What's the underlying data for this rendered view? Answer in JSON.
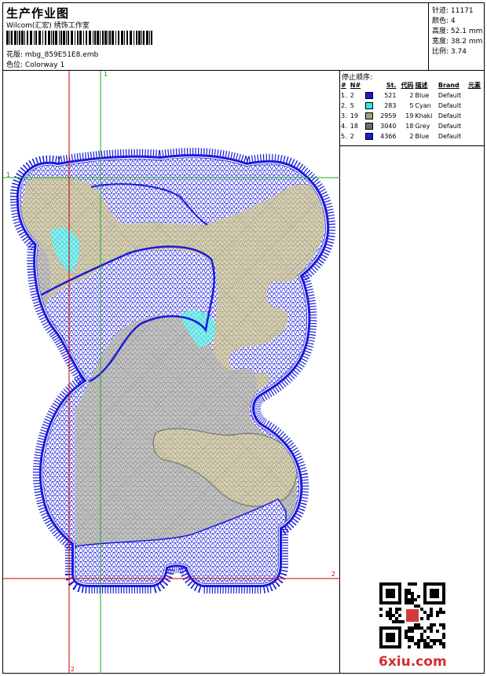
{
  "header": {
    "title": "生产作业图",
    "company": "Wilcom(汇宏) 绣饰工作室",
    "design_label": "花版:",
    "design_value": "mbg_859E51E8.emb",
    "colorway_label": "色位:",
    "colorway_value": "Colorway 1"
  },
  "stats": [
    {
      "label": "针迹:",
      "value": "11171"
    },
    {
      "label": "颜色:",
      "value": "4"
    },
    {
      "label": "高度:",
      "value": "52.1 mm"
    },
    {
      "label": "宽度:",
      "value": "38.2 mm"
    },
    {
      "label": "比例:",
      "value": "3.74"
    }
  ],
  "stop_sequence": {
    "title": "停止顺序:",
    "columns": [
      "#",
      "N#",
      "St.",
      "代码",
      "描述",
      "Brand",
      "元素"
    ],
    "rows": [
      {
        "num": "1.",
        "n": "2",
        "color": "#1a1adb",
        "st": "521",
        "code": "2",
        "desc": "Blue",
        "brand": "Default"
      },
      {
        "num": "2.",
        "n": "5",
        "color": "#2ee8e8",
        "st": "283",
        "code": "5",
        "desc": "Cyan",
        "brand": "Default"
      },
      {
        "num": "3.",
        "n": "19",
        "color": "#a8a07a",
        "st": "2959",
        "code": "19",
        "desc": "Khaki",
        "brand": "Default"
      },
      {
        "num": "4.",
        "n": "18",
        "color": "#6e6e6e",
        "st": "3040",
        "code": "18",
        "desc": "Grey",
        "brand": "Default"
      },
      {
        "num": "5.",
        "n": "2",
        "color": "#1a1adb",
        "st": "4366",
        "code": "2",
        "desc": "Blue",
        "brand": "Default"
      }
    ]
  },
  "axes": {
    "v1": "1",
    "h1": "1",
    "h2": "2",
    "v2": "2"
  },
  "watermark": "6xiu.com",
  "colors": {
    "blue": "#1a1adb",
    "cyan": "#2ee8e8",
    "khaki": "#a8a07a",
    "grey": "#6e6e6e",
    "guide_red": "#cc0000",
    "guide_green": "#22aa22"
  }
}
